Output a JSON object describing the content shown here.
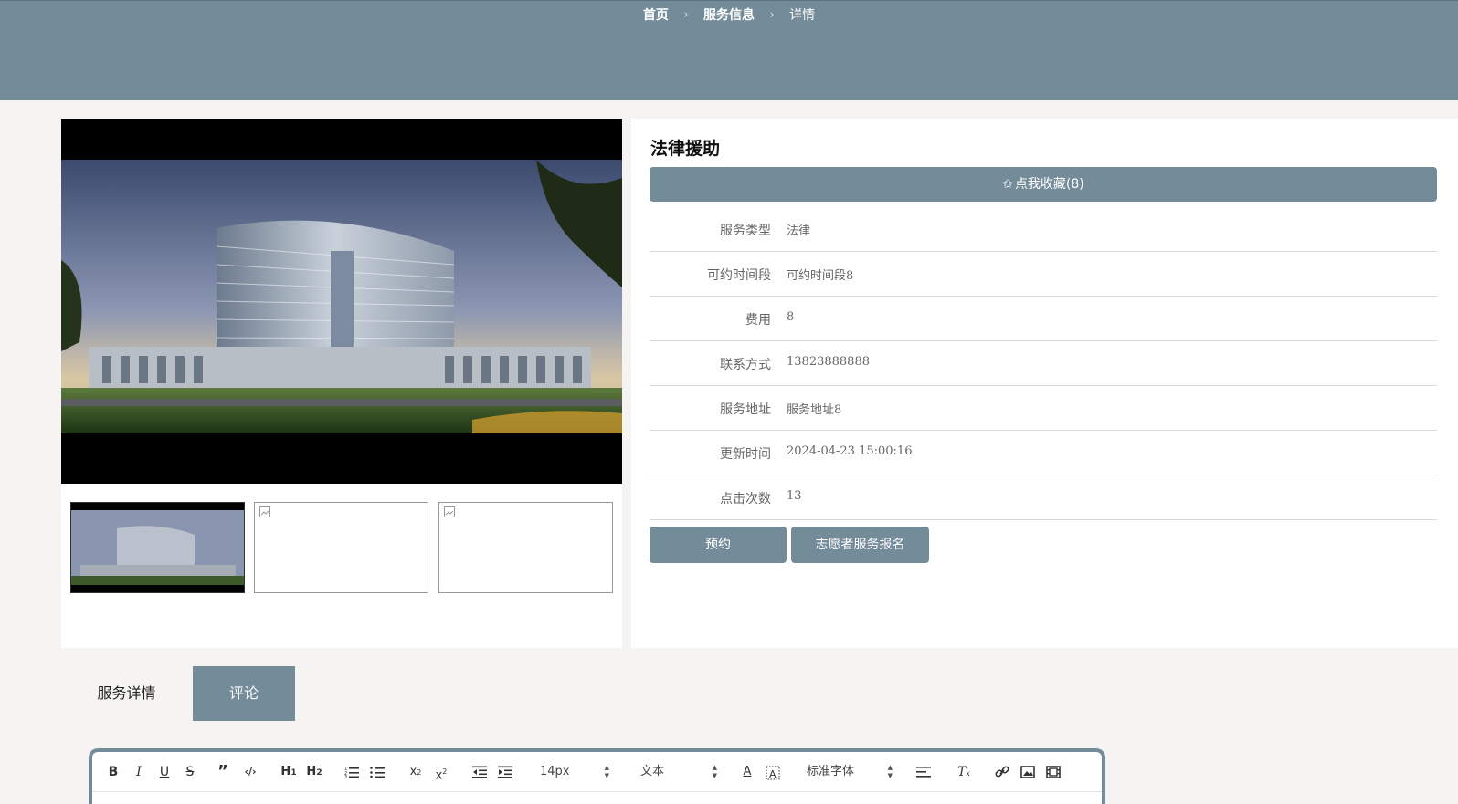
{
  "breadcrumb": {
    "home": "首页",
    "section": "服务信息",
    "current": "详情"
  },
  "service": {
    "title": "法律援助",
    "favorite_label": "点我收藏(8)",
    "fields": [
      {
        "label": "服务类型",
        "value": "法律"
      },
      {
        "label": "可约时间段",
        "value": "可约时间段8"
      },
      {
        "label": "费用",
        "value": "8"
      },
      {
        "label": "联系方式",
        "value": "13823888888"
      },
      {
        "label": "服务地址",
        "value": "服务地址8"
      },
      {
        "label": "更新时间",
        "value": "2024-04-23 15:00:16"
      },
      {
        "label": "点击次数",
        "value": "13"
      }
    ],
    "actions": {
      "book": "预约",
      "volunteer": "志愿者服务报名"
    }
  },
  "tabs": {
    "detail": "服务详情",
    "comment": "评论"
  },
  "editor": {
    "font_size": "14px",
    "block_format": "文本",
    "font_family": "标准字体",
    "icons": [
      "bold-icon",
      "italic-icon",
      "underline-icon",
      "strikethrough-icon",
      "blockquote-icon",
      "code-icon",
      "h1-icon",
      "h2-icon",
      "ordered-list-icon",
      "bullet-list-icon",
      "subscript-icon",
      "superscript-icon",
      "outdent-icon",
      "indent-icon",
      "font-color-icon",
      "background-color-icon",
      "align-icon",
      "clear-format-icon",
      "link-icon",
      "image-icon",
      "video-icon"
    ]
  },
  "colors": {
    "accent": "#748b9a",
    "background": "#f5f4f2"
  }
}
